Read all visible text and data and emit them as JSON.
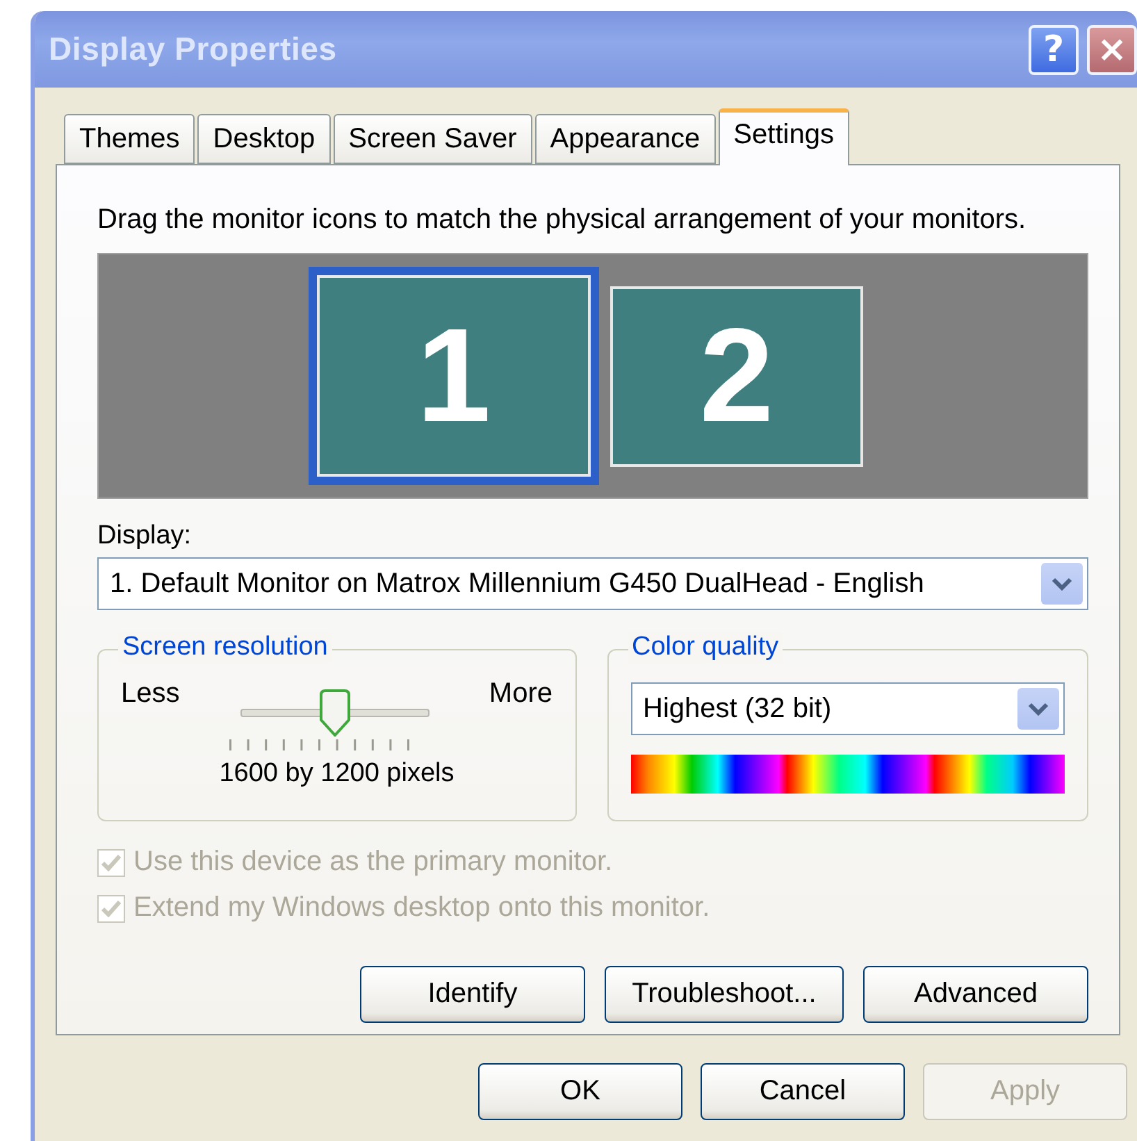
{
  "window": {
    "title": "Display Properties",
    "title_buttons": [
      {
        "kind": "help",
        "label": "?"
      },
      {
        "kind": "close",
        "label": "×"
      }
    ]
  },
  "tabs": [
    {
      "label": "Themes",
      "selected": false
    },
    {
      "label": "Desktop",
      "selected": false
    },
    {
      "label": "Screen Saver",
      "selected": false
    },
    {
      "label": "Appearance",
      "selected": false
    },
    {
      "label": "Settings",
      "selected": true
    }
  ],
  "instruction": "Drag the monitor icons to match the physical arrangement of your monitors.",
  "monitors": [
    {
      "label": "1",
      "selected": true
    },
    {
      "label": "2",
      "selected": false
    }
  ],
  "display": {
    "label": "Display:",
    "value": "1. Default Monitor on Matrox Millennium G450 DualHead - English"
  },
  "screen_resolution": {
    "title": "Screen resolution",
    "less": "Less",
    "more": "More",
    "level": 0.5,
    "reading": "1600 by 1200 pixels"
  },
  "color_quality": {
    "title": "Color quality",
    "value": "Highest (32 bit)"
  },
  "checkboxes": [
    {
      "label": "Use this device as the primary monitor.",
      "checked": true,
      "disabled": true
    },
    {
      "label": "Extend my Windows desktop onto this monitor.",
      "checked": true,
      "disabled": true
    }
  ],
  "panel_buttons": [
    {
      "label": "Identify",
      "disabled": false
    },
    {
      "label": "Troubleshoot...",
      "disabled": false
    },
    {
      "label": "Advanced",
      "disabled": false
    }
  ],
  "dialog_buttons": [
    {
      "label": "OK",
      "disabled": false
    },
    {
      "label": "Cancel",
      "disabled": false
    },
    {
      "label": "Apply",
      "disabled": true
    }
  ]
}
